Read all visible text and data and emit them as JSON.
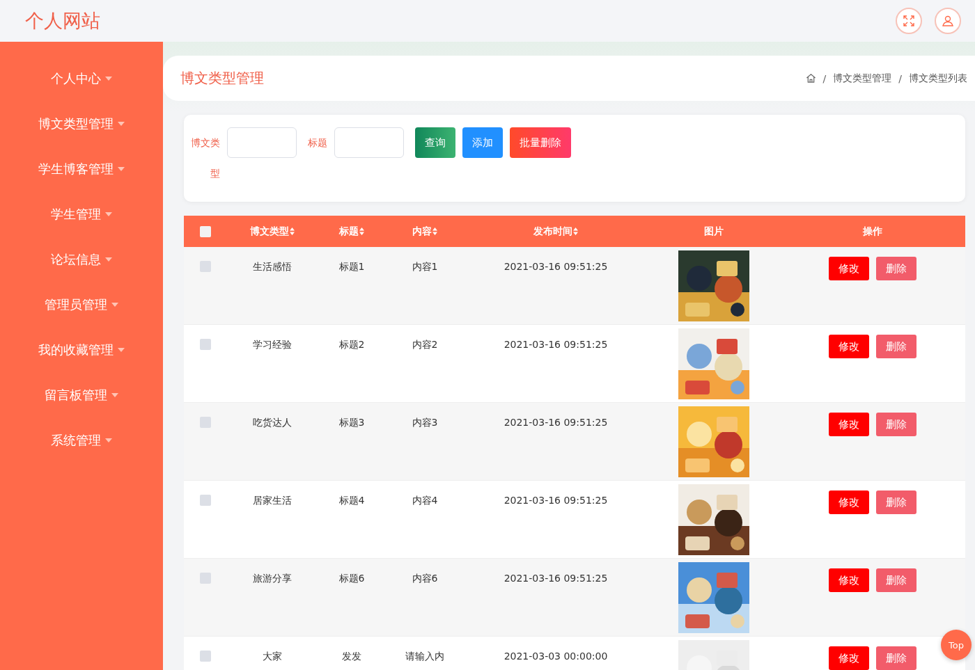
{
  "header": {
    "site_title": "个人网站"
  },
  "sidebar": {
    "items": [
      {
        "label": "个人中心"
      },
      {
        "label": "博文类型管理"
      },
      {
        "label": "学生博客管理"
      },
      {
        "label": "学生管理"
      },
      {
        "label": "论坛信息"
      },
      {
        "label": "管理员管理"
      },
      {
        "label": "我的收藏管理"
      },
      {
        "label": "留言板管理"
      },
      {
        "label": "系统管理"
      }
    ]
  },
  "page_title": "博文类型管理",
  "breadcrumb": [
    "博文类型管理",
    "博文类型列表"
  ],
  "breadcrumb_separator": "/",
  "search": {
    "fields": [
      {
        "label": "博文类型"
      },
      {
        "label": "标题"
      }
    ],
    "buttons": [
      {
        "label": "查询",
        "kind": "query"
      },
      {
        "label": "添加",
        "kind": "add"
      },
      {
        "label": "批量删除",
        "kind": "delete"
      }
    ]
  },
  "table": {
    "header_checked": false,
    "columns": [
      {
        "label": "博文类型",
        "sortable": true
      },
      {
        "label": "标题",
        "sortable": true
      },
      {
        "label": "内容",
        "sortable": true
      },
      {
        "label": "发布时间",
        "sortable": true
      },
      {
        "label": "图片",
        "sortable": false
      },
      {
        "label": "操作",
        "sortable": false
      }
    ],
    "rows": [
      {
        "checked": false,
        "type": "生活感悟",
        "title": "标题1",
        "content": "内容1",
        "time": "2021-03-16 09:51:25",
        "image": {
          "kind": "picture"
        },
        "actions": [
          "修改",
          "删除"
        ]
      },
      {
        "checked": false,
        "type": "学习经验",
        "title": "标题2",
        "content": "内容2",
        "time": "2021-03-16 09:51:25",
        "image": {
          "kind": "picture"
        },
        "actions": [
          "修改",
          "删除"
        ]
      },
      {
        "checked": false,
        "type": "吃货达人",
        "title": "标题3",
        "content": "内容3",
        "time": "2021-03-16 09:51:25",
        "image": {
          "kind": "picture"
        },
        "actions": [
          "修改",
          "删除"
        ]
      },
      {
        "checked": false,
        "type": "居家生活",
        "title": "标题4",
        "content": "内容4",
        "time": "2021-03-16 09:51:25",
        "image": {
          "kind": "picture"
        },
        "actions": [
          "修改",
          "删除"
        ]
      },
      {
        "checked": false,
        "type": "旅游分享",
        "title": "标题6",
        "content": "内容6",
        "time": "2021-03-16 09:51:25",
        "image": {
          "kind": "picture"
        },
        "actions": [
          "修改",
          "删除"
        ]
      },
      {
        "checked": false,
        "type": "大家",
        "title": "发发",
        "content": "请输入内",
        "time": "2021-03-03 00:00:00",
        "image": {
          "kind": "picture"
        },
        "actions": [
          "修改",
          "删除"
        ]
      }
    ]
  },
  "back_to_top": "Top"
}
